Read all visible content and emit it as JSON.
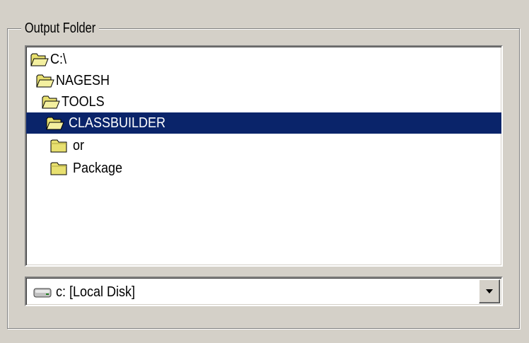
{
  "output_folder": {
    "legend": "Output Folder",
    "tree": [
      {
        "label": "C:\\",
        "icon": "open-folder-icon",
        "selected": false
      },
      {
        "label": "NAGESH",
        "icon": "open-folder-icon",
        "selected": false
      },
      {
        "label": "TOOLS",
        "icon": "open-folder-icon",
        "selected": false
      },
      {
        "label": "CLASSBUILDER",
        "icon": "open-folder-icon",
        "selected": true
      },
      {
        "label": "or",
        "icon": "closed-folder-icon",
        "selected": false
      },
      {
        "label": "Package",
        "icon": "closed-folder-icon",
        "selected": false
      }
    ],
    "drive": {
      "value": "c: [Local Disk]",
      "icon": "hard-drive-icon"
    }
  },
  "colors": {
    "face": "#d4d0c8",
    "selection": "#0a246a",
    "folder_yellow": "#e8e070"
  }
}
